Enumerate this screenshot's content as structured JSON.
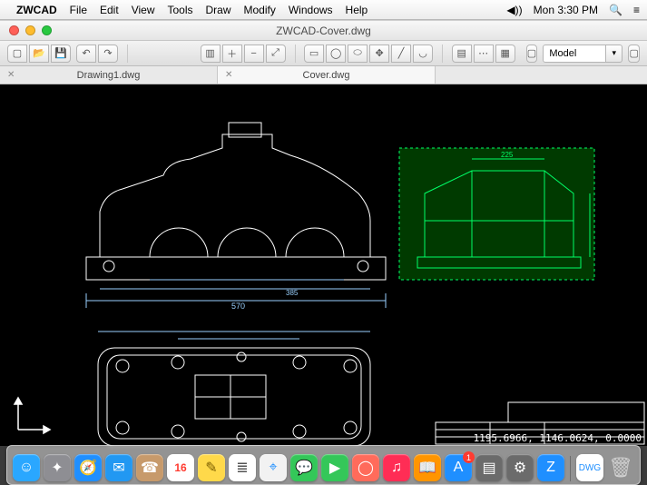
{
  "menubar": {
    "app": "ZWCAD",
    "items": [
      "File",
      "Edit",
      "View",
      "Tools",
      "Draw",
      "Modify",
      "Windows",
      "Help"
    ],
    "clock": "Mon 3:30 PM"
  },
  "window": {
    "title": "ZWCAD-Cover.dwg"
  },
  "toolbar": {
    "model_label": "Model"
  },
  "tabs": [
    {
      "label": "Drawing1.dwg",
      "active": false
    },
    {
      "label": "Cover.dwg",
      "active": true
    }
  ],
  "status": {
    "coords": "1195.6966, 1146.0624, 0.0000"
  },
  "drawing": {
    "dim_top_overall": "570",
    "dim_bottom_span": "385",
    "selection_color": "#00a000"
  },
  "dock": {
    "items": [
      {
        "name": "finder",
        "glyph": "☺",
        "bg": "#2aa7ff"
      },
      {
        "name": "launchpad",
        "glyph": "✦",
        "bg": "#8e8e93"
      },
      {
        "name": "safari",
        "glyph": "◎",
        "bg": "#1f8fff"
      },
      {
        "name": "mail",
        "glyph": "✉",
        "bg": "#2298f2"
      },
      {
        "name": "contacts",
        "glyph": "☎",
        "bg": "#c79a6b"
      },
      {
        "name": "calendar",
        "glyph": "16",
        "bg": "#ffffff"
      },
      {
        "name": "notes",
        "glyph": "✎",
        "bg": "#ffd94a"
      },
      {
        "name": "reminders",
        "glyph": "≣",
        "bg": "#ffffff"
      },
      {
        "name": "maps",
        "glyph": "⌖",
        "bg": "#f2f2f2"
      },
      {
        "name": "messages",
        "glyph": "✉",
        "bg": "#34c759"
      },
      {
        "name": "facetime",
        "glyph": "▶",
        "bg": "#34c759"
      },
      {
        "name": "photobooth",
        "glyph": "◯",
        "bg": "#ff6b5b"
      },
      {
        "name": "itunes",
        "glyph": "♫",
        "bg": "#ff2d55"
      },
      {
        "name": "ibooks",
        "glyph": "▭",
        "bg": "#ff9500"
      },
      {
        "name": "appstore",
        "glyph": "A",
        "bg": "#1f8fff"
      },
      {
        "name": "preview",
        "glyph": "▤",
        "bg": "#6b6b6b"
      },
      {
        "name": "sysprefs",
        "glyph": "⚙",
        "bg": "#6b6b6b"
      },
      {
        "name": "zwcad",
        "glyph": "Z",
        "bg": "#1f8fff"
      }
    ],
    "right": [
      {
        "name": "dwg-doc",
        "glyph": "▭",
        "bg": "#ffffff"
      },
      {
        "name": "trash",
        "glyph": "🗑",
        "bg": "transparent"
      }
    ]
  }
}
